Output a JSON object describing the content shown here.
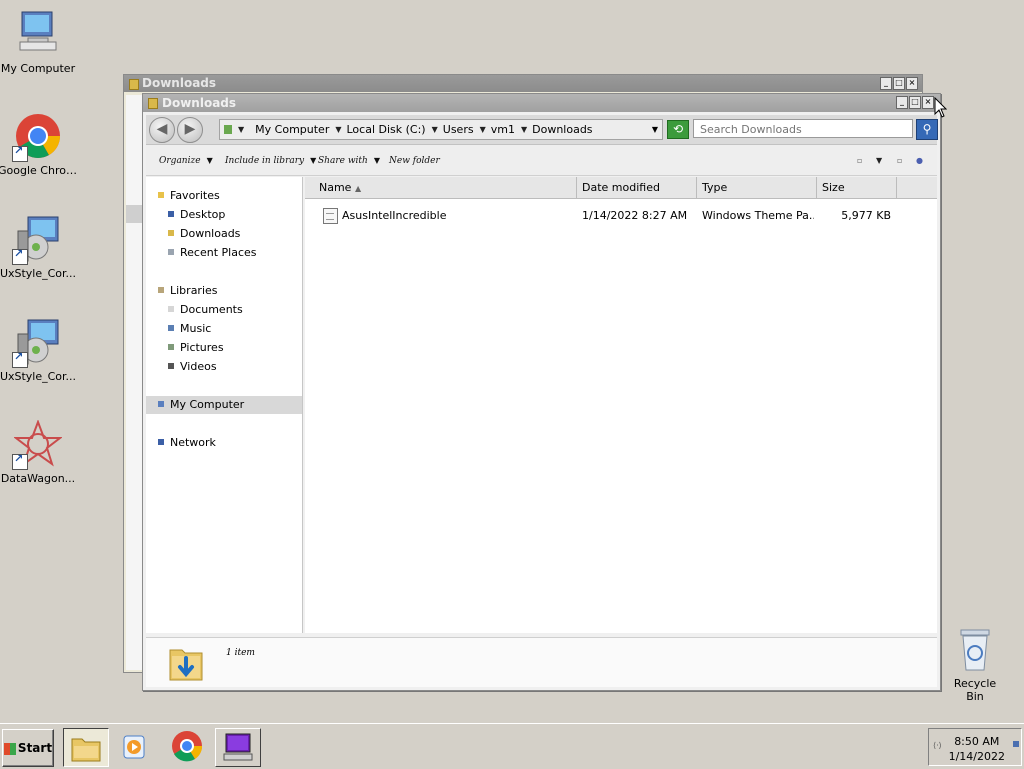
{
  "desktop": {
    "icons": [
      {
        "label": "My Computer"
      },
      {
        "label": "Google Chrome"
      },
      {
        "label": "UxStyle_Cor..."
      },
      {
        "label": "UxStyle_Cor..."
      },
      {
        "label": "DataWagon..."
      }
    ],
    "recycle_bin": "Recycle Bin"
  },
  "back_window": {
    "title": "Downloads"
  },
  "window": {
    "title": "Downloads",
    "breadcrumb": [
      "My Computer",
      "Local Disk (C:)",
      "Users",
      "vm1",
      "Downloads"
    ],
    "search_placeholder": "Search Downloads",
    "toolbar": {
      "organize": "Organize",
      "include_in_library": "Include in library",
      "share_with": "Share with",
      "new_folder": "New folder"
    },
    "nav": {
      "favorites": "Favorites",
      "desktop": "Desktop",
      "downloads": "Downloads",
      "recent_places": "Recent Places",
      "libraries": "Libraries",
      "documents": "Documents",
      "music": "Music",
      "pictures": "Pictures",
      "videos": "Videos",
      "my_computer": "My Computer",
      "network": "Network"
    },
    "columns": {
      "name": "Name",
      "date_modified": "Date modified",
      "type": "Type",
      "size": "Size"
    },
    "files": [
      {
        "name": "AsusIntelIncredible",
        "date_modified": "1/14/2022 8:27 AM",
        "type": "Windows Theme Pa...",
        "size": "5,977 KB"
      }
    ],
    "status": {
      "item_count": "1 item"
    }
  },
  "taskbar": {
    "start_label": "Start",
    "time": "8:50 AM",
    "date": "1/14/2022"
  }
}
